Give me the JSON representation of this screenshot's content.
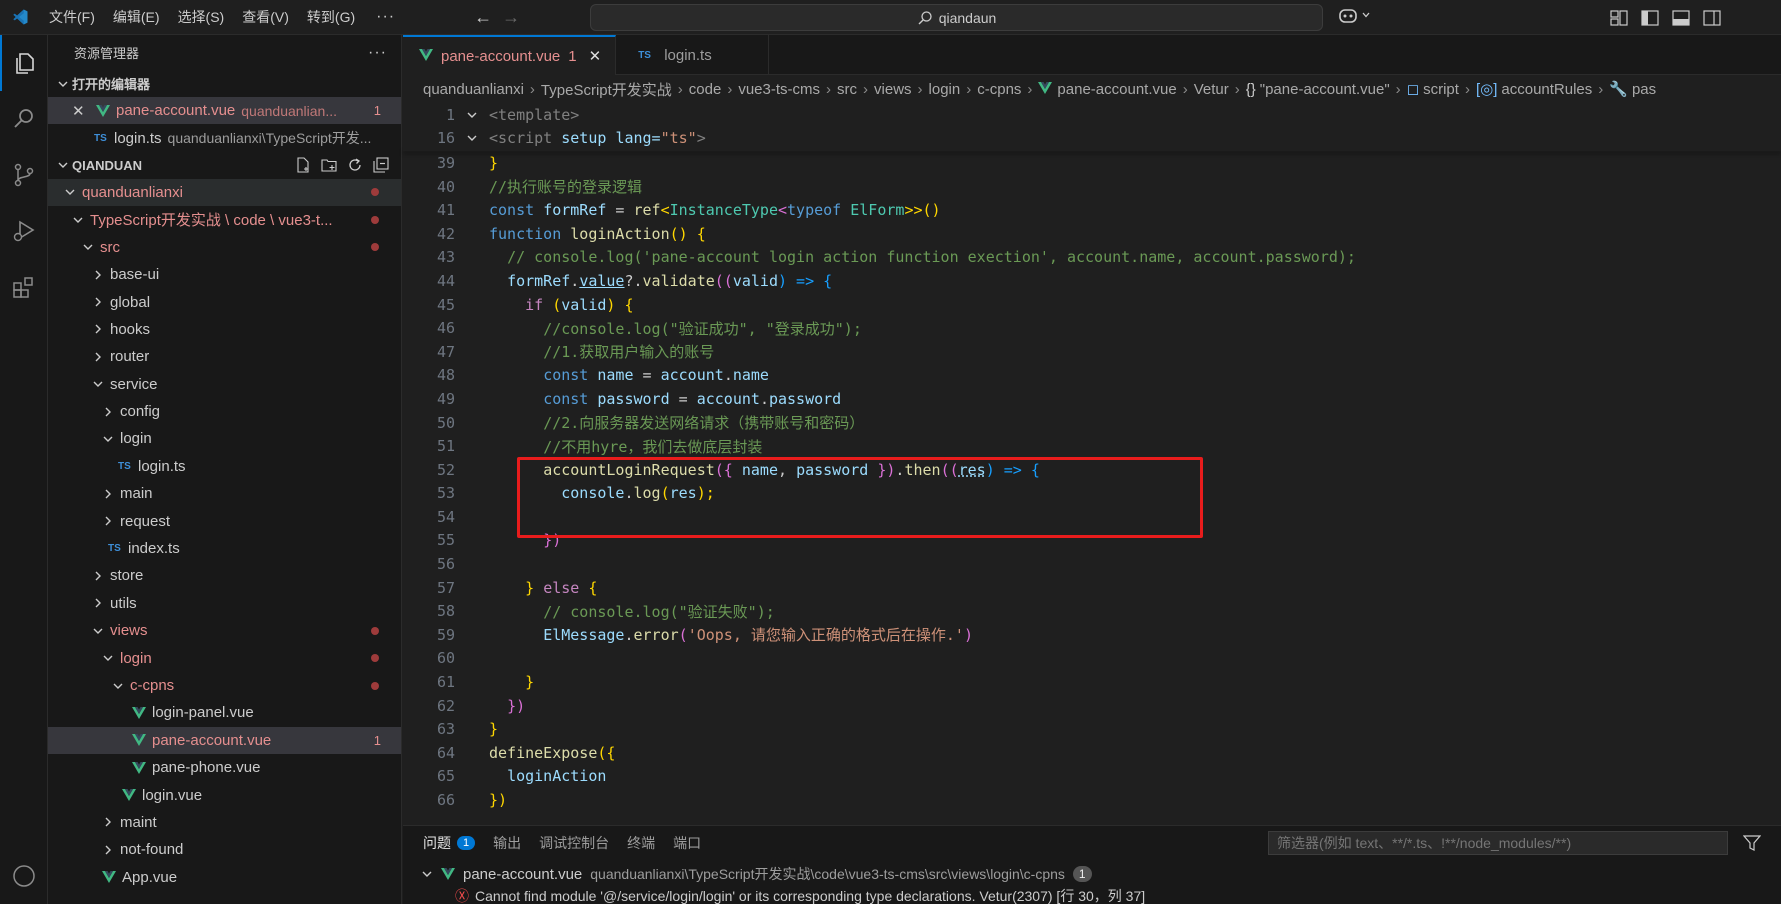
{
  "menu": [
    "文件(F)",
    "编辑(E)",
    "选择(S)",
    "查看(V)",
    "转到(G)"
  ],
  "search": {
    "text": "qiandaun"
  },
  "explorer": {
    "title": "资源管理器",
    "open_editors_title": "打开的编辑器",
    "open_editors": [
      {
        "name": "pane-account.vue",
        "path": "quanduanlian...",
        "badge": "1"
      },
      {
        "name": "login.ts",
        "path": "quanduanlianxi\\TypeScript开发..."
      }
    ],
    "folder_title": "QIANDUAN",
    "tree": [
      "quanduanlianxi",
      "TypeScript开发实战 \\ code \\ vue3-t...",
      "src",
      "base-ui",
      "global",
      "hooks",
      "router",
      "service",
      "config",
      "login",
      "login.ts",
      "main",
      "request",
      "index.ts",
      "store",
      "utils",
      "views",
      "login",
      "c-cpns",
      "login-panel.vue",
      "pane-account.vue",
      "pane-phone.vue",
      "login.vue",
      "maint",
      "not-found",
      "App.vue"
    ],
    "pane_account_badge": "1"
  },
  "tabs": [
    {
      "label": "pane-account.vue",
      "badge": "1"
    },
    {
      "label": "login.ts"
    }
  ],
  "breadcrumb": [
    "quanduanlianxi",
    "TypeScript开发实战",
    "code",
    "vue3-ts-cms",
    "src",
    "views",
    "login",
    "c-cpns",
    "pane-account.vue",
    "Vetur",
    "\"pane-account.vue\"",
    "script",
    "accountRules",
    "pas"
  ],
  "line_numbers": [
    "1",
    "16",
    "39",
    "40",
    "41",
    "42",
    "43",
    "44",
    "45",
    "46",
    "47",
    "48",
    "49",
    "50",
    "51",
    "52",
    "53",
    "54",
    "55",
    "56",
    "57",
    "58",
    "59",
    "60",
    "61",
    "62",
    "63",
    "64",
    "65",
    "66"
  ],
  "code": {
    "l1": "<template>",
    "l16a": "<script ",
    "l16b": "setup ",
    "l16c": "lang=",
    "l16d": "\"ts\"",
    "l16e": ">",
    "l39": "}",
    "l40": "//执行账号的登录逻辑",
    "l41a": "const ",
    "l41b": "formRef",
    "l41c": " = ",
    "l41d": "ref",
    "l41e": "<",
    "l41f": "InstanceType",
    "l41g": "<",
    "l41h": "typeof ",
    "l41i": "ElForm",
    "l41j": ">>",
    "l41k": "()",
    "l42a": "function ",
    "l42b": "loginAction",
    "l42c": "() {",
    "l43": "// console.log('pane-account login action function exection', account.name, account.password);",
    "l44a": "formRef",
    "l44b": ".",
    "l44c": "value",
    "l44d": "?.",
    "l44e": "validate",
    "l44f": "((",
    "l44g": "valid",
    "l44h": ") => {",
    "l45a": "if ",
    "l45b": "(",
    "l45c": "valid",
    "l45d": ") {",
    "l46": "//console.log(\"验证成功\", \"登录成功\");",
    "l47": "//1.获取用户输入的账号",
    "l48a": "const ",
    "l48b": "name",
    "l48c": " = ",
    "l48d": "account",
    "l48e": ".",
    "l48f": "name",
    "l49a": "const ",
    "l49b": "password",
    "l49c": " = ",
    "l49d": "account",
    "l49e": ".",
    "l49f": "password",
    "l50": "//2.向服务器发送网络请求（携带账号和密码）",
    "l51": "//不用hyre，我们去做底层封装",
    "l52a": "accountLoginRequest",
    "l52b": "({ ",
    "l52c": "name",
    "l52d": ", ",
    "l52e": "password",
    "l52f": " })",
    "l52g": ".",
    "l52h": "then",
    "l52i": "((",
    "l52j": "res",
    "l52k": ") => {",
    "l53a": "console",
    "l53b": ".",
    "l53c": "log",
    "l53d": "(",
    "l53e": "res",
    "l53f": ");",
    "l55": "})",
    "l57a": "} ",
    "l57b": "else ",
    "l57c": "{",
    "l58": "// console.log(\"验证失败\");",
    "l59a": "ElMessage",
    "l59b": ".",
    "l59c": "error",
    "l59d": "(",
    "l59e": "'Oops, 请您输入正确的格式后在操作.'",
    "l59f": ")",
    "l61": "}",
    "l62": "})",
    "l63": "}",
    "l64a": "defineExpose",
    "l64b": "({",
    "l65": "loginAction",
    "l66": "})"
  },
  "panel": {
    "tabs": [
      "问题",
      "输出",
      "调试控制台",
      "终端",
      "端口"
    ],
    "problems_count": "1",
    "filter_placeholder": "筛选器(例如 text、**/*.ts、!**/node_modules/**)",
    "file": "pane-account.vue",
    "path": "quanduanlianxi\\TypeScript开发实战\\code\\vue3-ts-cms\\src\\views\\login\\c-cpns",
    "file_count": "1",
    "error": "Cannot find module '@/service/login/login' or its corresponding type declarations. Vetur(2307) [行 30，列 37]"
  },
  "colors": {
    "accent": "#0078d4",
    "modified": "#e58f8f",
    "highlight_box": "#e81c1c"
  }
}
